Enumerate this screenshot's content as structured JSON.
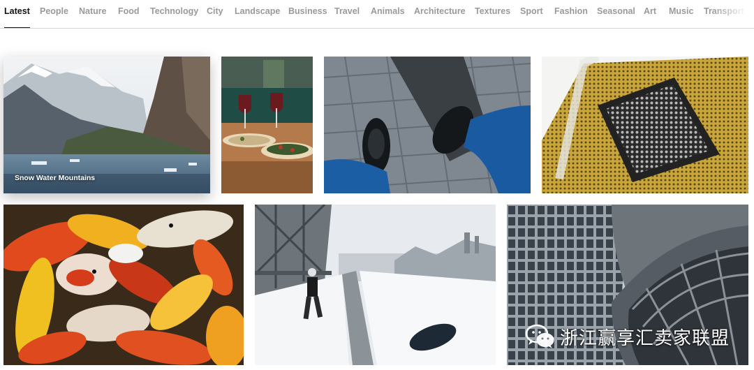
{
  "tabs": [
    {
      "label": "Latest",
      "active": true
    },
    {
      "label": "People"
    },
    {
      "label": "Nature"
    },
    {
      "label": "Food"
    },
    {
      "label": "Technology"
    },
    {
      "label": "City"
    },
    {
      "label": "Landscape"
    },
    {
      "label": "Business"
    },
    {
      "label": "Travel"
    },
    {
      "label": "Animals"
    },
    {
      "label": "Architecture"
    },
    {
      "label": "Textures"
    },
    {
      "label": "Sport"
    },
    {
      "label": "Fashion"
    },
    {
      "label": "Seasonal"
    },
    {
      "label": "Art"
    },
    {
      "label": "Music"
    },
    {
      "label": "Transport"
    }
  ],
  "gallery": {
    "row1": [
      {
        "caption": "Snow Water Mountains"
      },
      {
        "caption": ""
      },
      {
        "caption": ""
      },
      {
        "caption": ""
      }
    ],
    "row2": [
      {
        "caption": ""
      },
      {
        "caption": ""
      },
      {
        "caption": ""
      }
    ]
  },
  "watermark": {
    "icon": "wechat-icon",
    "text": "浙江赢享汇卖家联盟"
  }
}
